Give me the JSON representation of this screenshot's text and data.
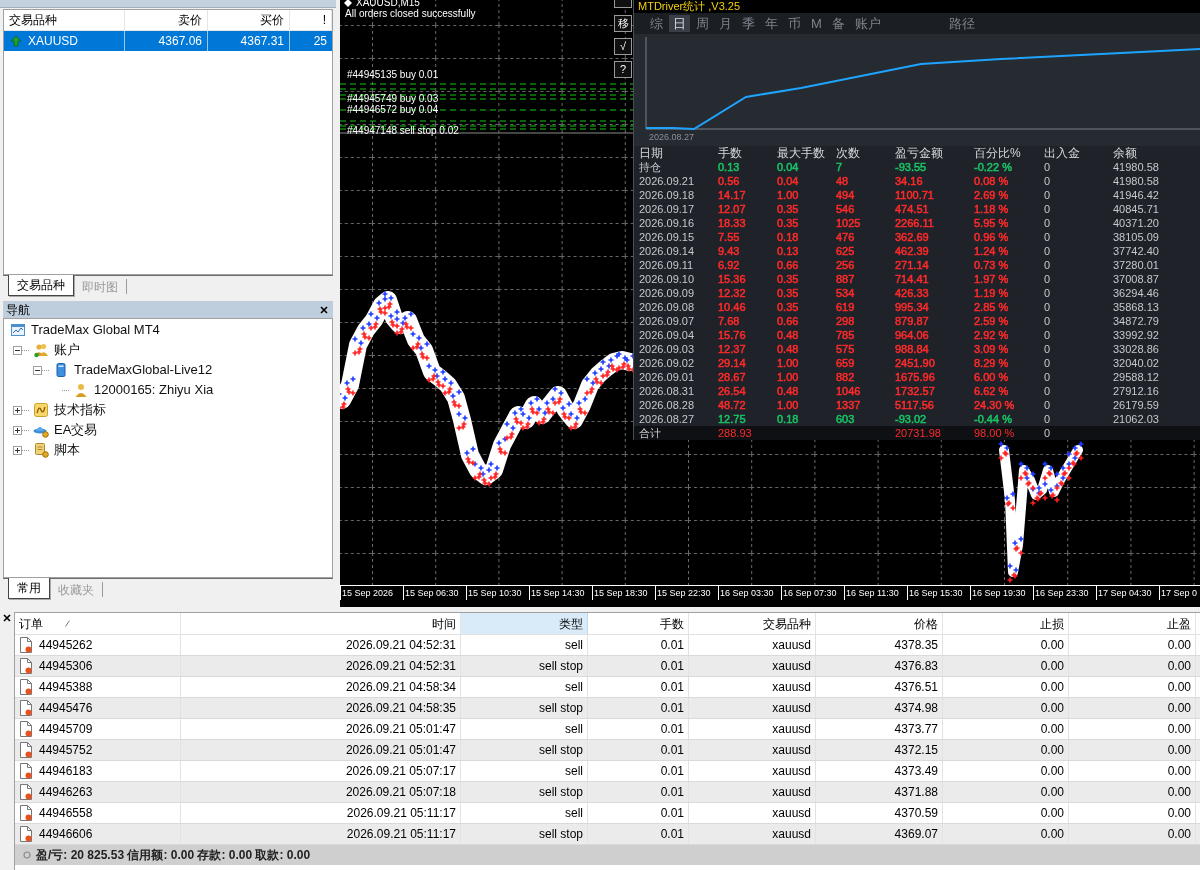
{
  "market_watch": {
    "columns": [
      "交易品种",
      "卖价",
      "买价",
      "!"
    ],
    "rows": [
      {
        "symbol": "XAUUSD",
        "bid": "4367.06",
        "ask": "4367.31",
        "spread": "25",
        "selected": true
      }
    ],
    "tabs": [
      {
        "label": "交易品种",
        "selected": true
      },
      {
        "label": "即时图",
        "selected": false
      }
    ]
  },
  "navigator": {
    "title": "导航",
    "tree": [
      {
        "label": "TradeMax Global MT4",
        "kind": "terminal",
        "children": [
          {
            "label": "账户",
            "kind": "accounts",
            "expanded": true,
            "children": [
              {
                "label": "TradeMaxGlobal-Live12",
                "kind": "server",
                "expanded": true,
                "children": [
                  {
                    "label": "12000165: Zhiyu Xia",
                    "kind": "account"
                  }
                ]
              }
            ]
          },
          {
            "label": "技术指标",
            "kind": "indicators",
            "expanded": false
          },
          {
            "label": "EA交易",
            "kind": "experts",
            "expanded": false
          },
          {
            "label": "脚本",
            "kind": "scripts",
            "expanded": false
          }
        ]
      }
    ],
    "tabs": [
      {
        "label": "常用",
        "selected": true
      },
      {
        "label": "收藏夹",
        "selected": false
      }
    ]
  },
  "chart": {
    "symbol": "XAUUSD,M15",
    "message": "All orders closed successfully",
    "order_labels": [
      "#44945135 buy 0.01",
      "#44945749 buy 0.03",
      "#44946572 buy 0.04",
      "#44947148 sell stop 0.02"
    ],
    "side_buttons": [
      "移",
      "√",
      "?"
    ],
    "time_axis": [
      "15 Sep 2026",
      "15 Sep 06:30",
      "15 Sep 10:30",
      "15 Sep 14:30",
      "15 Sep 18:30",
      "15 Sep 22:30",
      "16 Sep 03:30",
      "16 Sep 07:30",
      "16 Sep 11:30",
      "16 Sep 15:30",
      "16 Sep 19:30",
      "16 Sep 23:30",
      "17 Sep 04:30",
      "17 Sep 0"
    ]
  },
  "stats_panel": {
    "title": "MTDriver统计 ,V3.25",
    "tabs": [
      {
        "label": "综",
        "selected": false
      },
      {
        "label": "日",
        "selected": true
      },
      {
        "label": "周",
        "selected": false
      },
      {
        "label": "月",
        "selected": false
      },
      {
        "label": "季",
        "selected": false
      },
      {
        "label": "年",
        "selected": false
      },
      {
        "label": "币",
        "selected": false
      },
      {
        "label": "M",
        "selected": false
      },
      {
        "label": "备",
        "selected": false
      },
      {
        "label": "账户",
        "selected": false
      },
      {
        "label": "路径",
        "selected": false
      }
    ],
    "chart_label": "2026.08.27",
    "columns": [
      "日期",
      "手数",
      "最大手数",
      "次数",
      "盈亏金额",
      "百分比%",
      "出入金",
      "余额"
    ],
    "rows": [
      {
        "cells": [
          "持仓",
          "0.13",
          "0.04",
          "7",
          "-93.55",
          "-0.22 %",
          "0",
          "41980.58"
        ],
        "color": "#19c465"
      },
      {
        "cells": [
          "2026.09.21",
          "0.56",
          "0.04",
          "48",
          "34.16",
          "0.08 %",
          "0",
          "41980.58"
        ],
        "color": "#ff2a2a"
      },
      {
        "cells": [
          "2026.09.18",
          "14.17",
          "1.00",
          "494",
          "1100.71",
          "2.69 %",
          "0",
          "41946.42"
        ],
        "color": "#ff2a2a"
      },
      {
        "cells": [
          "2026.09.17",
          "12.07",
          "0.35",
          "546",
          "474.51",
          "1.18 %",
          "0",
          "40845.71"
        ],
        "color": "#ff2a2a"
      },
      {
        "cells": [
          "2026.09.16",
          "18.33",
          "0.35",
          "1025",
          "2266.11",
          "5.95 %",
          "0",
          "40371.20"
        ],
        "color": "#ff2a2a"
      },
      {
        "cells": [
          "2026.09.15",
          "7.55",
          "0.18",
          "476",
          "362.69",
          "0.96 %",
          "0",
          "38105.09"
        ],
        "color": "#ff2a2a"
      },
      {
        "cells": [
          "2026.09.14",
          "9.43",
          "0.13",
          "625",
          "462.39",
          "1.24 %",
          "0",
          "37742.40"
        ],
        "color": "#ff2a2a"
      },
      {
        "cells": [
          "2026.09.11",
          "6.92",
          "0.66",
          "256",
          "271.14",
          "0.73 %",
          "0",
          "37280.01"
        ],
        "color": "#ff2a2a"
      },
      {
        "cells": [
          "2026.09.10",
          "15.36",
          "0.35",
          "887",
          "714.41",
          "1.97 %",
          "0",
          "37008.87"
        ],
        "color": "#ff2a2a"
      },
      {
        "cells": [
          "2026.09.09",
          "12.32",
          "0.35",
          "534",
          "426.33",
          "1.19 %",
          "0",
          "36294.46"
        ],
        "color": "#ff2a2a"
      },
      {
        "cells": [
          "2026.09.08",
          "10.46",
          "0.35",
          "619",
          "995.34",
          "2.85 %",
          "0",
          "35868.13"
        ],
        "color": "#ff2a2a"
      },
      {
        "cells": [
          "2026.09.07",
          "7.68",
          "0.66",
          "298",
          "879.87",
          "2.59 %",
          "0",
          "34872.79"
        ],
        "color": "#ff2a2a"
      },
      {
        "cells": [
          "2026.09.04",
          "15.76",
          "0.48",
          "785",
          "964.06",
          "2.92 %",
          "0",
          "33992.92"
        ],
        "color": "#ff2a2a"
      },
      {
        "cells": [
          "2026.09.03",
          "12.37",
          "0.48",
          "575",
          "988.84",
          "3.09 %",
          "0",
          "33028.86"
        ],
        "color": "#ff2a2a"
      },
      {
        "cells": [
          "2026.09.02",
          "29.14",
          "1.00",
          "659",
          "2451.90",
          "8.29 %",
          "0",
          "32040.02"
        ],
        "color": "#ff2a2a"
      },
      {
        "cells": [
          "2026.09.01",
          "28.67",
          "1.00",
          "882",
          "1675.96",
          "6.00 %",
          "0",
          "29588.12"
        ],
        "color": "#ff2a2a"
      },
      {
        "cells": [
          "2026.08.31",
          "26.54",
          "0.48",
          "1046",
          "1732.57",
          "6.62 %",
          "0",
          "27912.16"
        ],
        "color": "#ff2a2a"
      },
      {
        "cells": [
          "2026.08.28",
          "48.72",
          "1.00",
          "1337",
          "5117.56",
          "24.30 %",
          "0",
          "26179.59"
        ],
        "color": "#ff2a2a"
      },
      {
        "cells": [
          "2026.08.27",
          "12.75",
          "0.18",
          "603",
          "-93.02",
          "-0.44 %",
          "0",
          "21062.03"
        ],
        "color": "#19c465"
      }
    ],
    "total": {
      "label": "合计",
      "lots": "288.93",
      "pnl": "20731.98",
      "percent": "98.00 %",
      "deposit": "0"
    }
  },
  "terminal": {
    "columns": [
      {
        "label": "订单",
        "sorted": true,
        "highlighted": false
      },
      {
        "label": "时间",
        "sorted": false,
        "highlighted": false
      },
      {
        "label": "类型",
        "sorted": false,
        "highlighted": true
      },
      {
        "label": "手数",
        "sorted": false,
        "highlighted": false
      },
      {
        "label": "交易品种",
        "sorted": false,
        "highlighted": false
      },
      {
        "label": "价格",
        "sorted": false,
        "highlighted": false
      },
      {
        "label": "止损",
        "sorted": false,
        "highlighted": false
      },
      {
        "label": "止盈",
        "sorted": false,
        "highlighted": false
      }
    ],
    "rows": [
      [
        "44945262",
        "2026.09.21 04:52:31",
        "sell",
        "0.01",
        "xauusd",
        "4378.35",
        "0.00",
        "0.00"
      ],
      [
        "44945306",
        "2026.09.21 04:52:31",
        "sell stop",
        "0.01",
        "xauusd",
        "4376.83",
        "0.00",
        "0.00"
      ],
      [
        "44945388",
        "2026.09.21 04:58:34",
        "sell",
        "0.01",
        "xauusd",
        "4376.51",
        "0.00",
        "0.00"
      ],
      [
        "44945476",
        "2026.09.21 04:58:35",
        "sell stop",
        "0.01",
        "xauusd",
        "4374.98",
        "0.00",
        "0.00"
      ],
      [
        "44945709",
        "2026.09.21 05:01:47",
        "sell",
        "0.01",
        "xauusd",
        "4373.77",
        "0.00",
        "0.00"
      ],
      [
        "44945752",
        "2026.09.21 05:01:47",
        "sell stop",
        "0.01",
        "xauusd",
        "4372.15",
        "0.00",
        "0.00"
      ],
      [
        "44946183",
        "2026.09.21 05:07:17",
        "sell",
        "0.01",
        "xauusd",
        "4373.49",
        "0.00",
        "0.00"
      ],
      [
        "44946263",
        "2026.09.21 05:07:18",
        "sell stop",
        "0.01",
        "xauusd",
        "4371.88",
        "0.00",
        "0.00"
      ],
      [
        "44946558",
        "2026.09.21 05:11:17",
        "sell",
        "0.01",
        "xauusd",
        "4370.59",
        "0.00",
        "0.00"
      ],
      [
        "44946606",
        "2026.09.21 05:11:17",
        "sell stop",
        "0.01",
        "xauusd",
        "4369.07",
        "0.00",
        "0.00"
      ]
    ],
    "summary": "盈/亏: 20 825.53 信用额: 0.00 存款: 0.00 取款: 0.00"
  }
}
